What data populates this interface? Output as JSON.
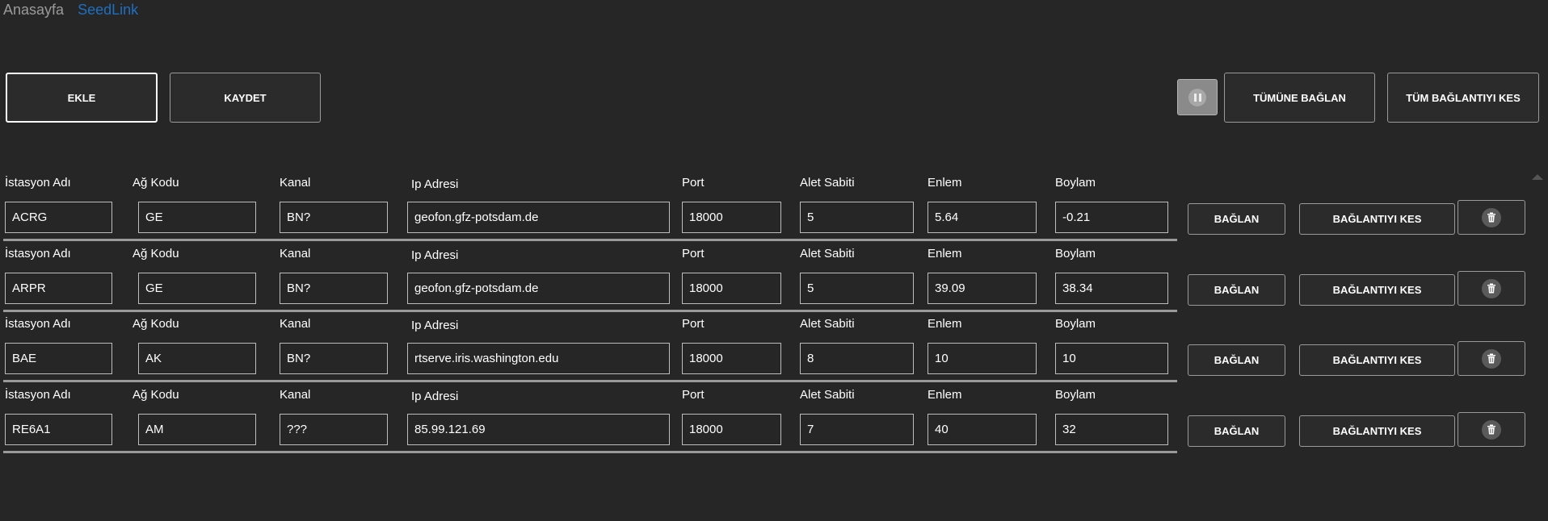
{
  "nav": {
    "home": "Anasayfa",
    "seedlink": "SeedLink"
  },
  "toolbar": {
    "add": "EKLE",
    "save": "KAYDET",
    "connect_all": "TÜMÜNE BAĞLAN",
    "disconnect_all": "TÜM BAĞLANTIYI KES",
    "pause_icon": "pause-icon"
  },
  "labels": {
    "station": "İstasyon Adı",
    "network": "Ağ Kodu",
    "channel": "Kanal",
    "ip": "Ip Adresi",
    "port": "Port",
    "constant": "Alet Sabiti",
    "lat": "Enlem",
    "lon": "Boylam",
    "connect": "BAĞLAN",
    "disconnect": "BAĞLANTIYI KES"
  },
  "stations": [
    {
      "station": "ACRG",
      "network": "GE",
      "channel": "BN?",
      "ip": "geofon.gfz-potsdam.de",
      "port": "18000",
      "constant": "5",
      "lat": "5.64",
      "lon": "-0.21"
    },
    {
      "station": "ARPR",
      "network": "GE",
      "channel": "BN?",
      "ip": "geofon.gfz-potsdam.de",
      "port": "18000",
      "constant": "5",
      "lat": "39.09",
      "lon": "38.34"
    },
    {
      "station": "BAE",
      "network": "AK",
      "channel": "BN?",
      "ip": "rtserve.iris.washington.edu",
      "port": "18000",
      "constant": "8",
      "lat": "10",
      "lon": "10"
    },
    {
      "station": "RE6A1",
      "network": "AM",
      "channel": "???",
      "ip": "85.99.121.69",
      "port": "18000",
      "constant": "7",
      "lat": "40",
      "lon": "32"
    }
  ],
  "colors": {
    "background": "#262626",
    "link": "#1f6fbf",
    "border": "#bdbdbd"
  }
}
